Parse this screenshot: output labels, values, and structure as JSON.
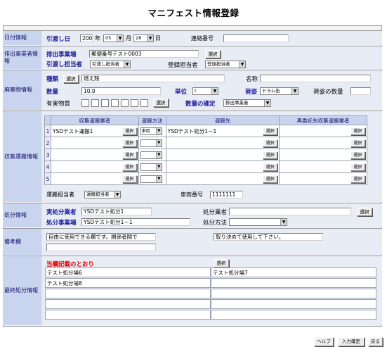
{
  "page": {
    "title": "マニフェスト情報登録"
  },
  "date_section": {
    "label": "日付情報",
    "field_label": "引渡し日",
    "year": "2002",
    "year_unit": "年",
    "month": "05",
    "month_unit": "月",
    "day": "28",
    "day_unit": "日",
    "contact_label": "連絡番号",
    "contact_value": ""
  },
  "emitter_section": {
    "label": "排出事業者情報",
    "site_label": "排出事業場",
    "site_value": "郵便番号テスト0003",
    "select_button": "選択",
    "person_label": "引渡し担当者",
    "person_select": "引渡し担当者",
    "reg_person_label": "登録担当者",
    "reg_person_select": "登録担当者"
  },
  "waste_section": {
    "label": "廃棄物情報",
    "type_label": "種類",
    "type_button": "選択",
    "type_value": "燃え殻",
    "name_label": "名称",
    "name_value": "",
    "qty_label": "数量",
    "qty_value": "10.0",
    "unit_label": "単位",
    "unit_value": "t",
    "packing_label": "荷姿",
    "packing_value": "ドラム缶",
    "packing_qty_label": "荷姿の数量",
    "packing_qty_value": "",
    "hazard_label": "有害物質",
    "hazard_button": "選択",
    "confirm_label": "数量の確定",
    "confirm_value": "排出事業者"
  },
  "transport_section": {
    "label": "収集運搬情報",
    "headers": [
      "収集運搬業者",
      "運搬方法",
      "運搬先",
      "再委託先収集運搬業者"
    ],
    "select_button": "選択",
    "rows": [
      {
        "no": "1",
        "carrier": "YSDテスト運搬1",
        "method": "車両",
        "dest": "YSDテスト処分1－1"
      },
      {
        "no": "2",
        "carrier": "",
        "method": "",
        "dest": ""
      },
      {
        "no": "3",
        "carrier": "",
        "method": "",
        "dest": ""
      },
      {
        "no": "4",
        "carrier": "",
        "method": "",
        "dest": ""
      },
      {
        "no": "5",
        "carrier": "",
        "method": "",
        "dest": ""
      }
    ],
    "person_label": "運搬担当者",
    "person_select": "運搬担当者",
    "vehicle_label": "車両番号",
    "vehicle_value": "1111111"
  },
  "disposal_section": {
    "label": "処分情報",
    "company_label": "実処分業者",
    "company_value": "YSDテスト処分1",
    "site_label": "処分事業場",
    "site_value": "YSDテスト処分1－1",
    "processor_label": "処分業者",
    "processor_value": "",
    "method_label": "処分方法",
    "method_value": "",
    "select_button": "選択"
  },
  "notes_section": {
    "label": "備考欄",
    "note1": "自由に使用できる欄です。関係者間で",
    "note2": "",
    "note3": "取り決めて使用して下さい。"
  },
  "final_section": {
    "label": "最終処分情報",
    "heading": "当欄記載のとおり",
    "select_button": "選択",
    "sites": [
      "テスト処分場6",
      "テスト処分場7",
      "テスト処分場8"
    ]
  },
  "footer": {
    "help_button": "ヘルプ",
    "confirm_button": "入力確定",
    "back_button": "戻る"
  }
}
